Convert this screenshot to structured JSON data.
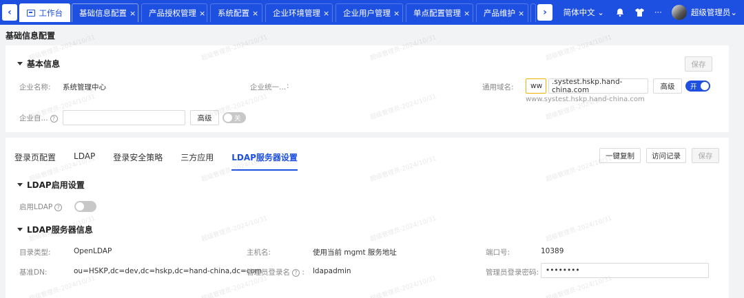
{
  "header": {
    "tabs": [
      {
        "label": "工作台",
        "closable": false
      },
      {
        "label": "基础信息配置",
        "closable": true
      },
      {
        "label": "产品授权管理",
        "closable": true
      },
      {
        "label": "系统配置",
        "closable": true
      },
      {
        "label": "企业环境管理",
        "closable": true
      },
      {
        "label": "企业用户管理",
        "closable": true
      },
      {
        "label": "单点配置管理",
        "closable": true
      },
      {
        "label": "产品维护",
        "closable": true
      }
    ],
    "close_glyph": "×",
    "prev_glyph": "‹",
    "next_glyph": "›",
    "language": "简体中文",
    "user": "超级管理员",
    "more_glyph": "···"
  },
  "page_title": "基础信息配置",
  "basic_info": {
    "section_title": "基本信息",
    "save_label": "保存",
    "company_name_label": "企业名称:",
    "company_name_value": "系统管理中心",
    "credit_code_label": "企业统一...",
    "credit_code_value": ":",
    "domain_label": "通用域名:",
    "domain_prefix": "ww",
    "domain_suffix": ".systest.hskp.hand-china.com",
    "domain_advanced_label": "高级",
    "domain_switch_text": "开",
    "domain_hint": "www.systest.hskp.hand-china.com",
    "self_label": "企业自...",
    "self_help": "?",
    "self_value": "",
    "self_advanced_label": "高级",
    "self_switch_text": "关"
  },
  "config": {
    "tabs": [
      "登录页配置",
      "LDAP",
      "登录安全策略",
      "三方应用",
      "LDAP服务器设置"
    ],
    "active_tab": 4,
    "copy_label": "一键复制",
    "history_label": "访问记录",
    "save_label": "保存",
    "ldap_enable_title": "LDAP启用设置",
    "enable_ldap_label": "启用LDAP",
    "enable_help": "?",
    "enable_ldap_on": false,
    "server_title": "LDAP服务器信息",
    "dir_type_label": "目录类型:",
    "dir_type_value": "OpenLDAP",
    "host_label": "主机名:",
    "host_value": "使用当前 mgmt 服务地址",
    "port_label": "端口号:",
    "port_value": "10389",
    "base_dn_label": "基准DN:",
    "base_dn_value": "ou=HSKP,dc=dev,dc=hskp,dc=hand-china,dc=com",
    "admin_login_label": "管理员登录名",
    "admin_help": "?",
    "admin_login_sep": ":",
    "admin_login_value": "ldapadmin",
    "admin_pwd_label": "管理员登录密码:",
    "admin_pwd_value": "••••••••"
  },
  "watermark": "超级管理员-2024/10/31",
  "colors": {
    "primary": "#1d4fe0",
    "warning_border": "#f3b400"
  }
}
